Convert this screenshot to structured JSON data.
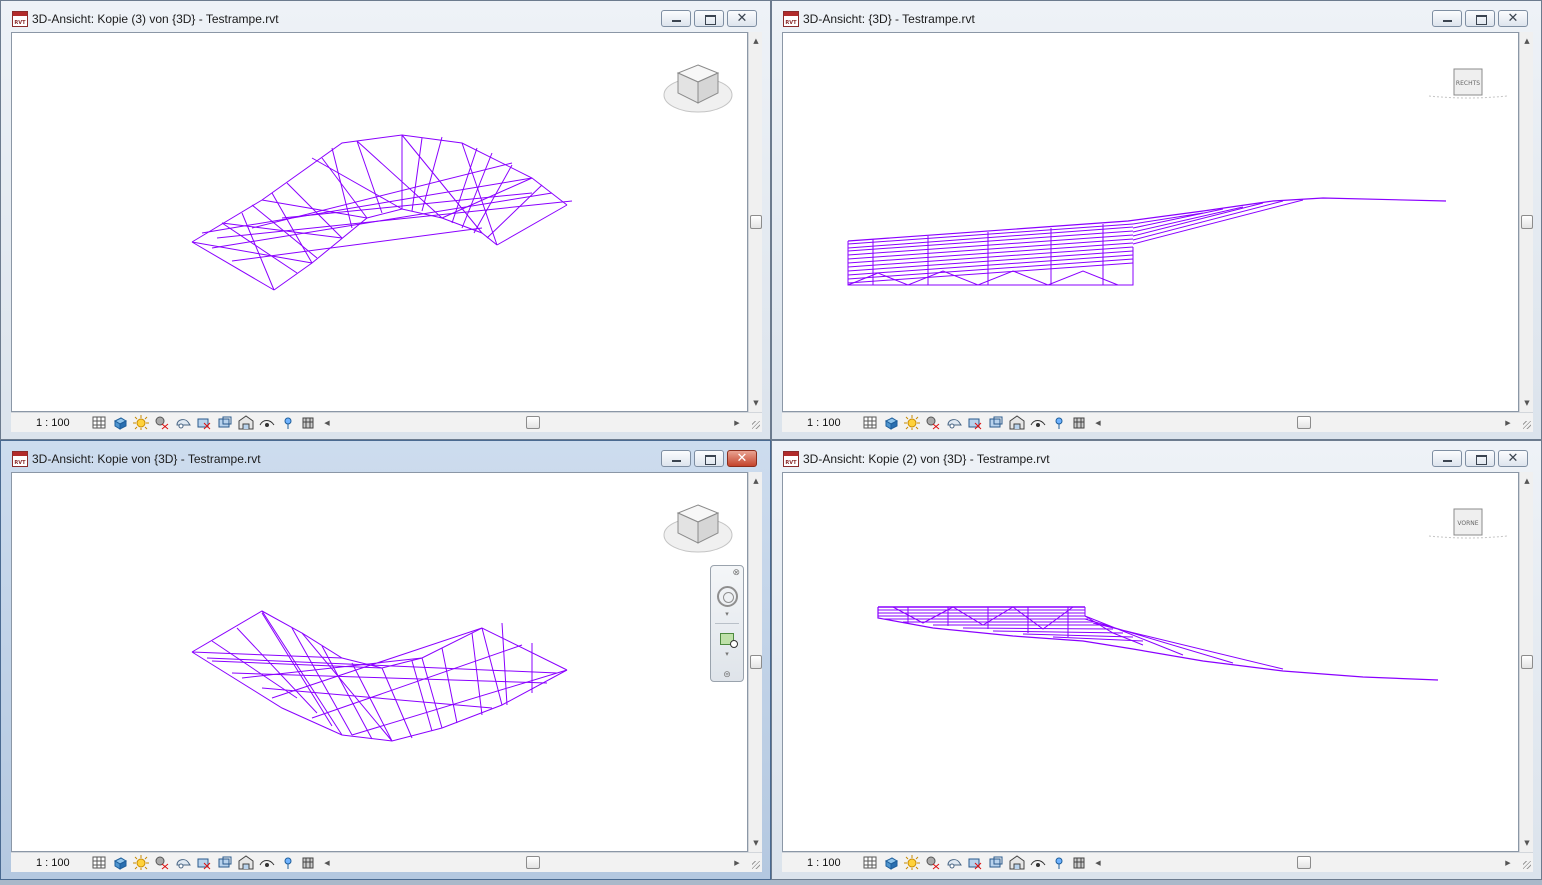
{
  "windows": [
    {
      "title": "3D-Ansicht: Kopie (3) von {3D} - Testrampe.rvt",
      "scale": "1 : 100",
      "app_icon": "RVT",
      "active": false,
      "close_hot": false,
      "view": "iso-top",
      "viewcube": "3d-cube"
    },
    {
      "title": "3D-Ansicht: {3D} - Testrampe.rvt",
      "scale": "1 : 100",
      "app_icon": "RVT",
      "active": false,
      "close_hot": false,
      "view": "side-right",
      "viewcube_label": "RECHTS"
    },
    {
      "title": "3D-Ansicht: Kopie von {3D} - Testrampe.rvt",
      "scale": "1 : 100",
      "app_icon": "RVT",
      "active": true,
      "close_hot": true,
      "view": "iso-bottom",
      "viewcube": "3d-cube",
      "navigation_bar": true
    },
    {
      "title": "3D-Ansicht: Kopie (2) von {3D} - Testrampe.rvt",
      "scale": "1 : 100",
      "app_icon": "RVT",
      "active": false,
      "close_hot": false,
      "view": "side-front",
      "viewcube_label": "VORNE"
    }
  ],
  "window_controls": {
    "minimize": "",
    "maximize": "",
    "close": "✕"
  },
  "view_control_icons": [
    "detail-level-icon",
    "visual-style-icon",
    "sun-path-icon",
    "shadows-icon",
    "rendering-icon",
    "crop-view-icon",
    "show-crop-region-icon",
    "temporary-hide-icon",
    "reveal-hidden-icon",
    "analysis-icon",
    "highlight-icon",
    "worksharing-icon"
  ],
  "colors": {
    "model_lines": "#8a00ff",
    "canvas": "#ffffff",
    "active_title": "#b4c8e0",
    "close_hot": "#c4432b"
  }
}
